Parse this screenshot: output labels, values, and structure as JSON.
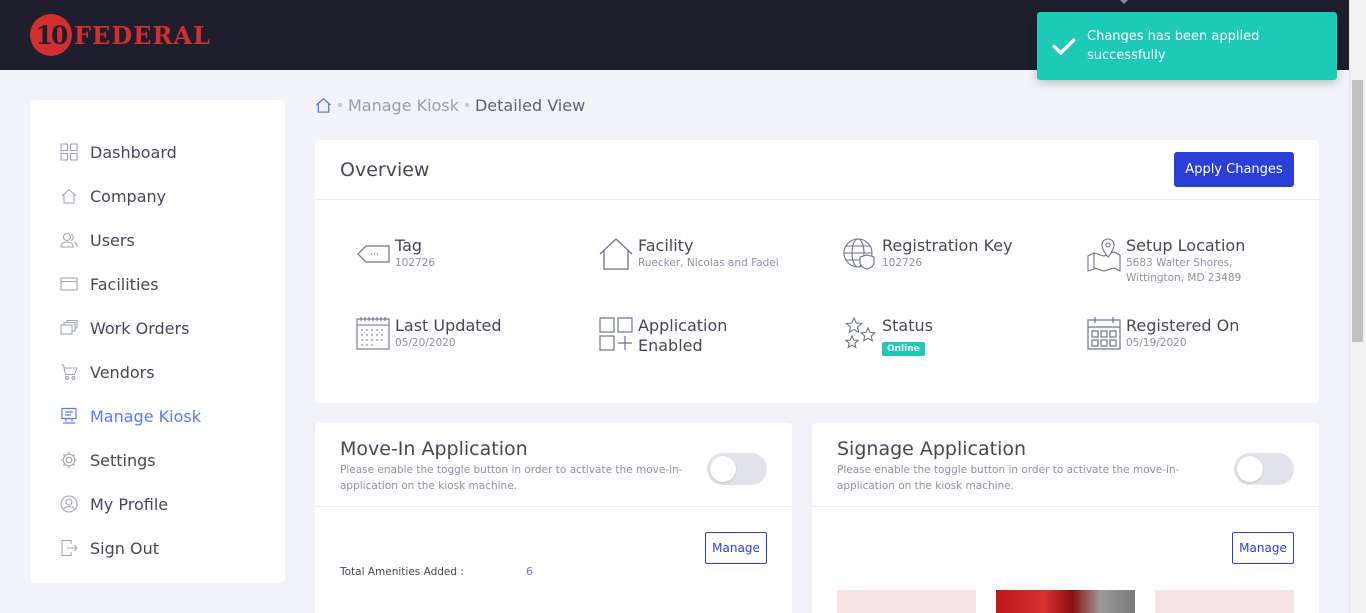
{
  "brand": {
    "logo_number": "10",
    "logo_text": "FEDERAL"
  },
  "toast": {
    "message": "Changes has been applied successfully"
  },
  "sidebar": {
    "items": [
      {
        "label": "Dashboard",
        "icon": "grid-icon"
      },
      {
        "label": "Company",
        "icon": "home-icon"
      },
      {
        "label": "Users",
        "icon": "users-icon"
      },
      {
        "label": "Facilities",
        "icon": "archive-icon"
      },
      {
        "label": "Work Orders",
        "icon": "stack-icon"
      },
      {
        "label": "Vendors",
        "icon": "cart-icon"
      },
      {
        "label": "Manage Kiosk",
        "icon": "kiosk-icon",
        "active": true
      },
      {
        "label": "Settings",
        "icon": "gear-icon"
      },
      {
        "label": "My Profile",
        "icon": "user-circle-icon"
      },
      {
        "label": "Sign Out",
        "icon": "sign-out-icon"
      }
    ]
  },
  "breadcrumb": {
    "parent": "Manage Kiosk",
    "current": "Detailed View"
  },
  "overview": {
    "title": "Overview",
    "apply_label": "Apply Changes",
    "tag": {
      "label": "Tag",
      "value": "102726"
    },
    "facility": {
      "label": "Facility",
      "value": "Ruecker, Nicolas and Fadel"
    },
    "registration_key": {
      "label": "Registration Key",
      "value": "102726"
    },
    "setup_location": {
      "label": "Setup Location",
      "line1": "5683 Walter Shores,",
      "line2": "Wittington, MD 23489"
    },
    "last_updated": {
      "label": "Last Updated",
      "value": "05/20/2020"
    },
    "application": {
      "label_line1": "Application",
      "label_line2": "Enabled"
    },
    "status": {
      "label": "Status",
      "value": "Online"
    },
    "registered_on": {
      "label": "Registered On",
      "value": "05/19/2020"
    }
  },
  "movein": {
    "title": "Move-In Application",
    "description": "Please enable the toggle button in order to activate the move-in-application on the kiosk machine.",
    "enabled": false,
    "manage_label": "Manage",
    "amenities_label": "Total Amenities Added :",
    "amenities_value": "6"
  },
  "signage": {
    "title": "Signage Application",
    "description": "Please enable the toggle button in order to activate the move-in-application on the kiosk machine.",
    "enabled": false,
    "manage_label": "Manage"
  },
  "colors": {
    "accent": "#2c3ed8",
    "success": "#1dc9b7",
    "topbar": "#1e1e2d",
    "brand_red": "#d32f2f"
  }
}
